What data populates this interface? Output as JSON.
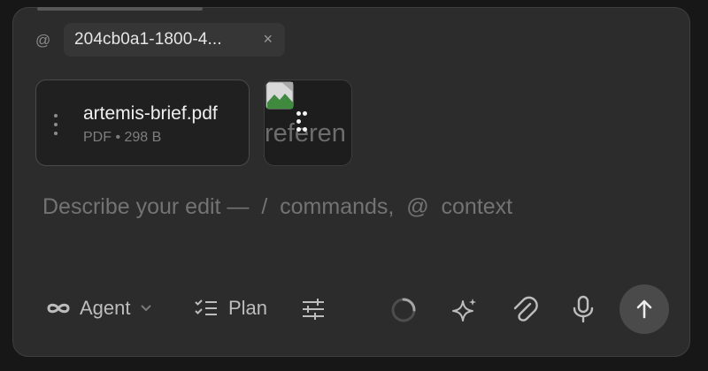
{
  "context": {
    "at_symbol": "@",
    "chip_label": "204cb0a1-1800-4...",
    "chip_close": "×"
  },
  "attachments": [
    {
      "name": "artemis-brief.pdf",
      "meta": "PDF • 298 B"
    },
    {
      "alt_text": "referen"
    }
  ],
  "prompt": {
    "placeholder": "Describe your edit —  /  commands,  @  context"
  },
  "toolbar": {
    "agent_label": "Agent",
    "plan_label": "Plan",
    "icons": [
      "infinity-icon",
      "chevron-down-icon",
      "checklist-icon",
      "sliders-icon",
      "spinner-icon",
      "sparkle-icon",
      "paperclip-icon",
      "microphone-icon",
      "arrow-up-icon"
    ]
  },
  "colors": {
    "panel_bg": "#2c2c2c",
    "page_bg": "#171717",
    "send_button_bg": "#4a4a4a",
    "muted_text": "#737373"
  }
}
